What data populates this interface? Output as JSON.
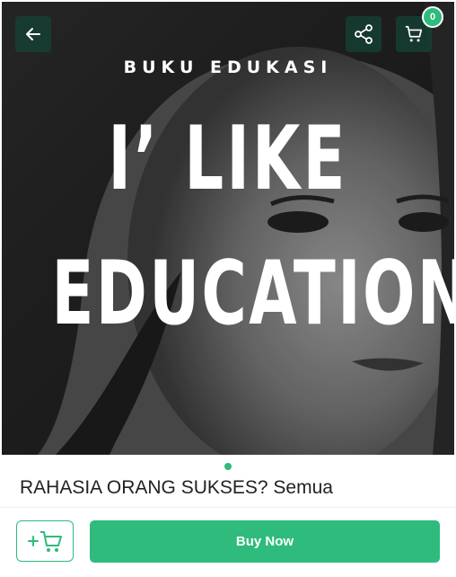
{
  "header": {
    "back_icon": "arrow-left-icon",
    "share_icon": "share-icon",
    "cart_icon": "cart-icon",
    "cart_count": "0"
  },
  "cover": {
    "kicker": "BUKU EDUKASI",
    "line1": "I’ LIKE",
    "line2": "EDUCATION"
  },
  "carousel": {
    "current_index": 1,
    "total": 1
  },
  "product": {
    "title": "RAHASIA ORANG SUKSES? Semua"
  },
  "actions": {
    "add_to_cart_icon": "add-to-cart-icon",
    "buy_now_label": "Buy Now"
  },
  "colors": {
    "accent": "#2ebb7c",
    "icon_button_bg": "#144637",
    "text": "#222222"
  }
}
